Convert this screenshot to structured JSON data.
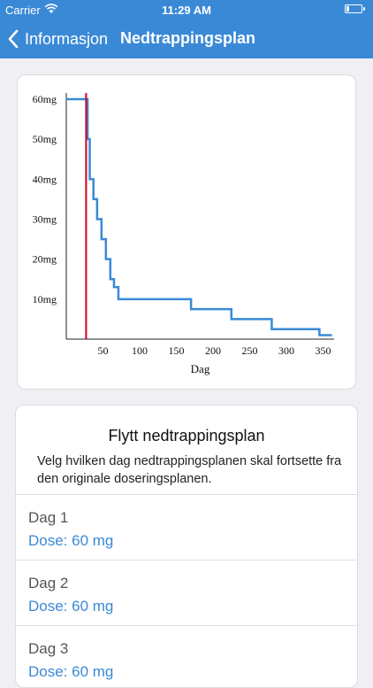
{
  "status_bar": {
    "carrier": "Carrier",
    "time": "11:29 AM"
  },
  "nav": {
    "back_label": "Informasjon",
    "title": "Nedtrappingsplan"
  },
  "chart_data": {
    "type": "line",
    "xlabel": "Dag",
    "ylabel": "",
    "x_ticks": [
      50,
      100,
      150,
      200,
      250,
      300,
      350
    ],
    "y_ticks": [
      10,
      20,
      30,
      40,
      50,
      60
    ],
    "y_tick_labels": [
      "10mg",
      "20mg",
      "30mg",
      "40mg",
      "50mg",
      "60mg"
    ],
    "xlim": [
      0,
      365
    ],
    "ylim": [
      0,
      60
    ],
    "series": [
      {
        "color": "#3a89d6",
        "step": true,
        "x": [
          0,
          29,
          32,
          37,
          42,
          48,
          54,
          60,
          65,
          71,
          78,
          85,
          170,
          225,
          280,
          345,
          362
        ],
        "y": [
          60,
          50,
          40,
          35,
          30,
          25,
          20,
          15,
          13,
          10,
          10,
          10,
          7.5,
          5,
          2.5,
          1,
          1
        ]
      }
    ],
    "marker": {
      "x": 27,
      "color": "#d0021b"
    }
  },
  "plan": {
    "heading": "Flytt nedtrappingsplan",
    "description": "Velg hvilken dag nedtrappingsplanen skal fortsette fra den originale doseringsplanen.",
    "days": [
      {
        "day": "Dag 1",
        "dose": "Dose: 60 mg"
      },
      {
        "day": "Dag 2",
        "dose": "Dose: 60 mg"
      },
      {
        "day": "Dag 3",
        "dose": "Dose: 60 mg"
      }
    ]
  }
}
